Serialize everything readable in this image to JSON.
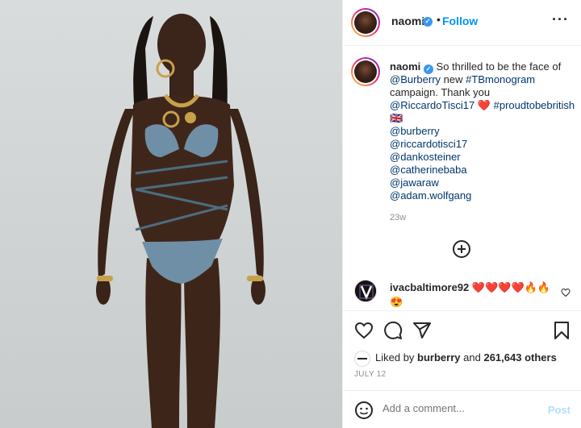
{
  "header": {
    "username": "naomi",
    "separator": "•",
    "follow_label": "Follow",
    "more_label": "···"
  },
  "caption": {
    "username": "naomi",
    "text_1": "So thrilled to be the face of",
    "mention_brand": "@Burberry",
    "text_2": "new",
    "hashtag_1": "#TBmonogram",
    "text_3": "campaign. Thank you",
    "mention_designer": "@RiccardoTisci17",
    "heart_emoji": "❤️",
    "hashtag_2": "#proudtobebritish",
    "flag_emoji": "🇬🇧",
    "mentions": [
      "@burberry",
      "@riccardotisci17",
      "@dankosteiner",
      "@catherinebaba",
      "@jawaraw",
      "@adam.wolfgang"
    ],
    "age": "23w"
  },
  "comment": {
    "username": "ivacbaltimore92",
    "text": "❤️❤️❤️❤️🔥🔥😍"
  },
  "likes": {
    "prefix": "Liked by",
    "liker": "burberry",
    "and": "and",
    "count_text": "261,643 others"
  },
  "date": "JULY 12",
  "add_comment": {
    "placeholder": "Add a comment...",
    "post_label": "Post"
  },
  "icons": {
    "more": "more-options-icon",
    "verified": "verified-badge-icon",
    "load_more": "plus-circle-icon",
    "comment_like": "heart-outline-icon",
    "like": "heart-outline-icon",
    "comment": "comment-bubble-icon",
    "share": "paper-plane-icon",
    "save": "bookmark-icon",
    "emoji": "emoji-smile-icon"
  },
  "colors": {
    "link": "#00376b",
    "follow": "#0095f6",
    "verified": "#3897f0",
    "post_disabled": "#b2dffc",
    "muted": "#8e8e8e"
  }
}
